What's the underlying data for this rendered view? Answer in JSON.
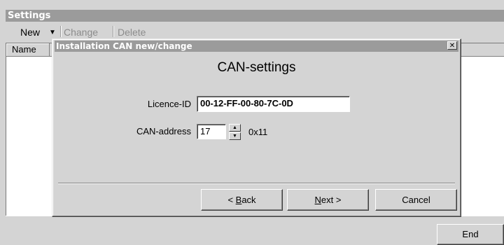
{
  "outer": {
    "title": "Settings",
    "toolbar": {
      "new_label": "New",
      "new_dropdown_glyph": "▼",
      "change_label": "Change",
      "delete_label": "Delete"
    },
    "list": {
      "columns": [
        "Name"
      ]
    },
    "end_label": "End"
  },
  "dialog": {
    "title": "Installation CAN new/change",
    "close_glyph": "✕",
    "heading": "CAN-settings",
    "licence_label": "Licence-ID",
    "licence_value": "00-12-FF-00-80-7C-0D",
    "can_label": "CAN-address",
    "can_value": "17",
    "can_hex": "0x11",
    "back_prefix": "< ",
    "back_mnemonic": "B",
    "back_rest": "ack",
    "next_mnemonic": "N",
    "next_rest": "ext >",
    "cancel_label": "Cancel"
  },
  "icons": {
    "spin_up": "chevron-up-icon",
    "spin_down": "chevron-down-icon",
    "close": "close-icon"
  }
}
